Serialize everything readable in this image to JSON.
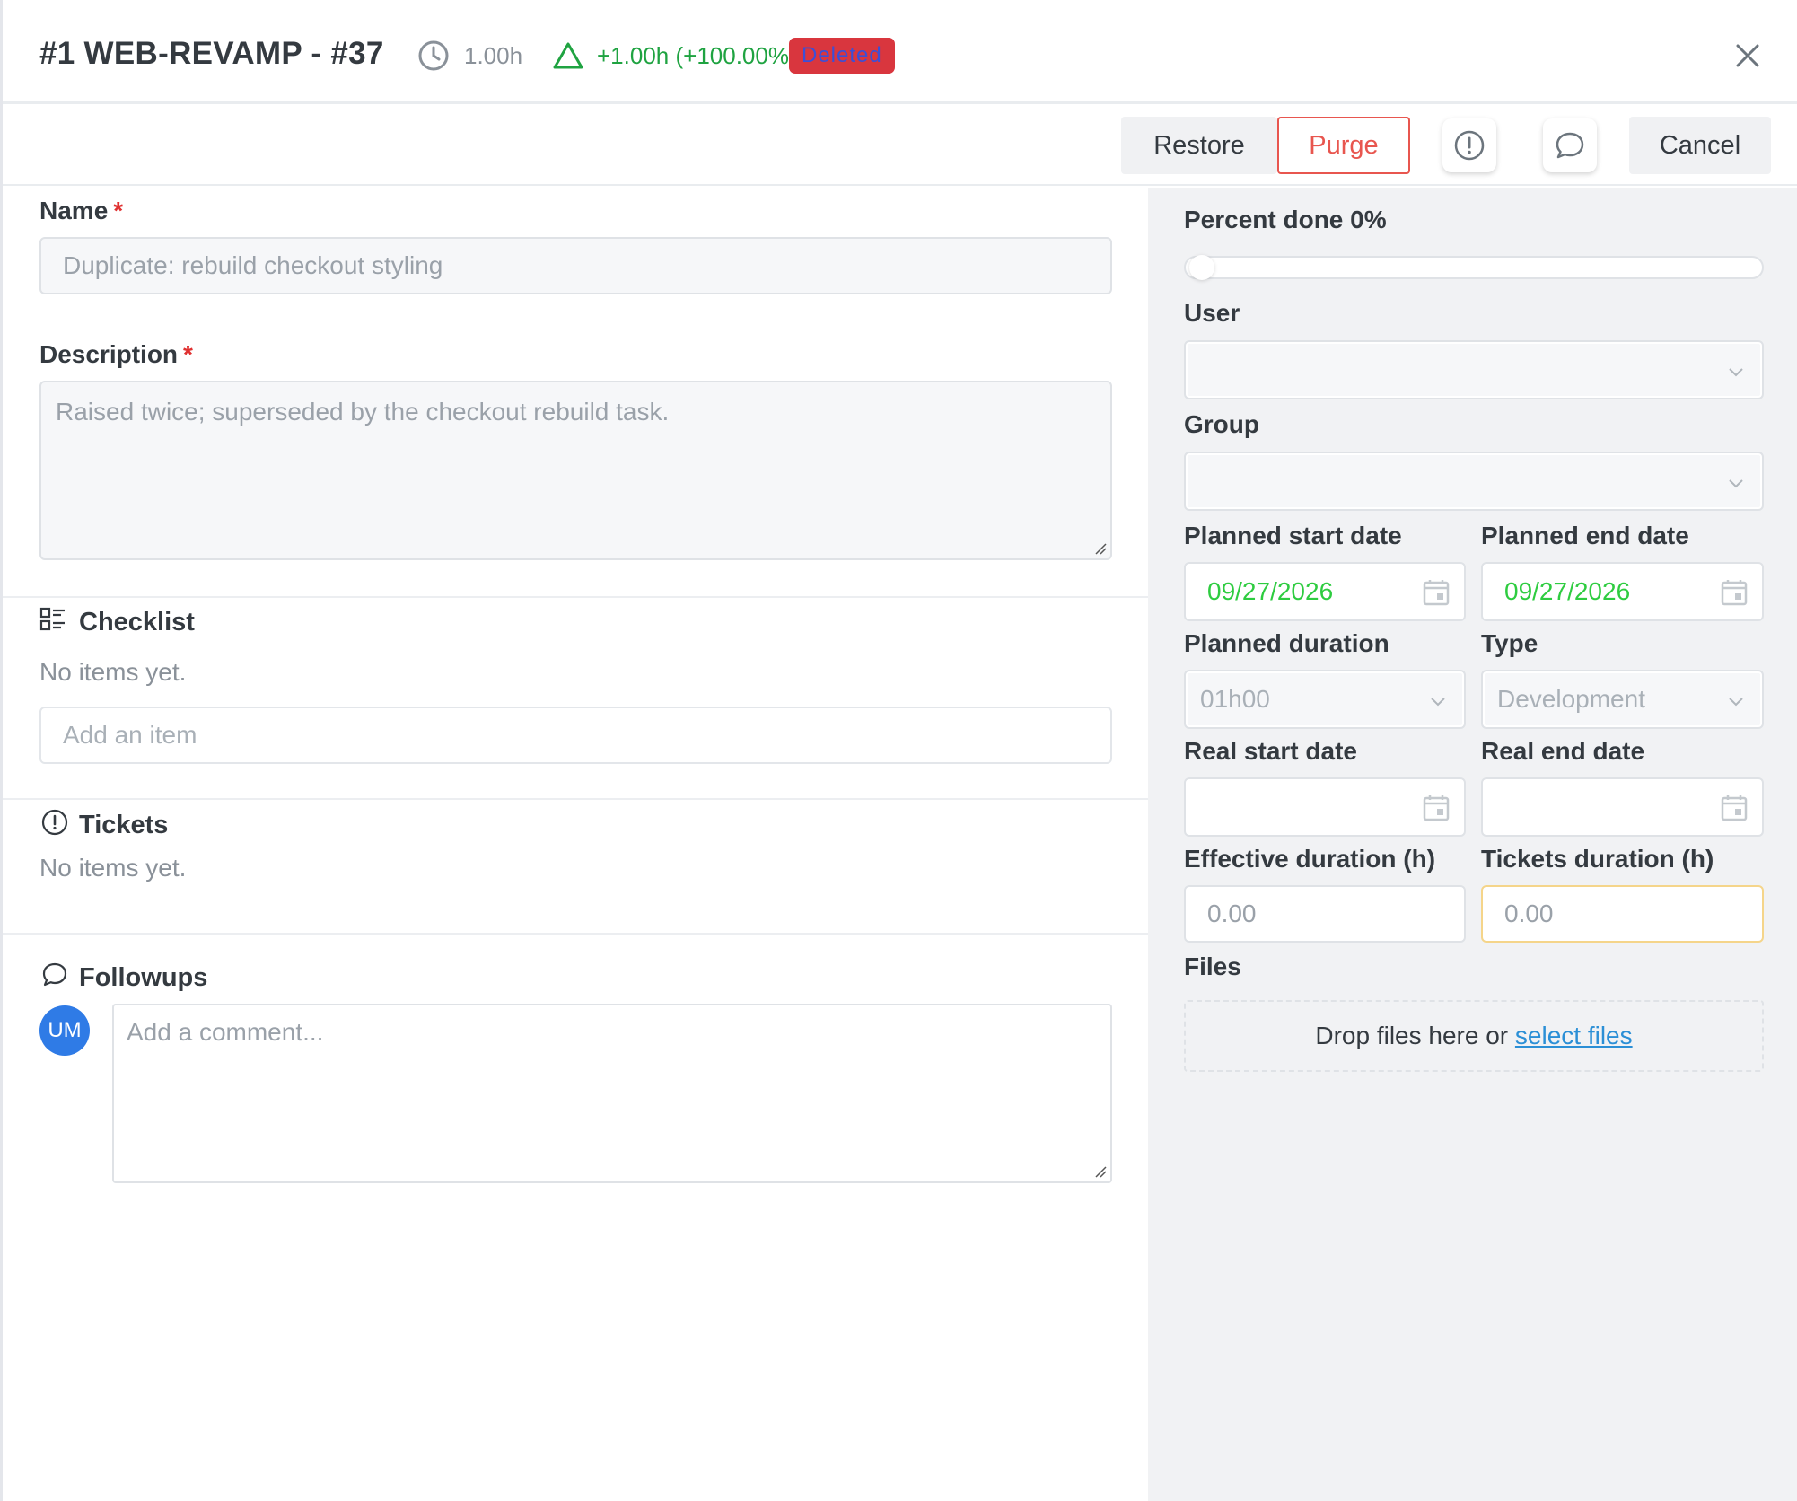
{
  "header": {
    "title": "#1 WEB-REVAMP - #37",
    "time": "1.00h",
    "delta": "+1.00h (+100.00%)",
    "status_badge": "Deleted"
  },
  "toolbar": {
    "restore_label": "Restore",
    "purge_label": "Purge",
    "cancel_label": "Cancel",
    "tickets_icon": "exclamation-circle-icon",
    "comments_icon": "chat-bubble-icon"
  },
  "form": {
    "name_label": "Name",
    "required_mark": "*",
    "name_value": "Duplicate: rebuild checkout styling",
    "description_label": "Description",
    "description_value": "Raised twice; superseded by the checkout rebuild task."
  },
  "checklist": {
    "title": "Checklist",
    "empty_text": "No items yet.",
    "add_placeholder": "Add an item"
  },
  "tickets": {
    "title": "Tickets",
    "empty_text": "No items yet."
  },
  "followups": {
    "title": "Followups",
    "avatar_initials": "UM",
    "comment_placeholder": "Add a comment..."
  },
  "sidebar": {
    "percent_label": "Percent done 0%",
    "percent_done": 0,
    "user_label": "User",
    "group_label": "Group",
    "planned_start_label": "Planned start date",
    "planned_start_value": "09/27/2026",
    "planned_end_label": "Planned end date",
    "planned_end_value": "09/27/2026",
    "planned_duration_label": "Planned duration",
    "planned_duration_value": "01h00",
    "type_label": "Type",
    "type_value": "Development",
    "real_start_label": "Real start date",
    "real_end_label": "Real end date",
    "effective_duration_label": "Effective duration (h)",
    "effective_duration_value": "0.00",
    "tickets_duration_label": "Tickets duration (h)",
    "tickets_duration_value": "0.00",
    "files_label": "Files",
    "dropzone_text": "Drop files here or",
    "dropzone_link": "select files"
  },
  "colors": {
    "danger": "#d9363e",
    "success": "#1fa341",
    "date_green": "#2ecc40",
    "accent_blue": "#2f7be6",
    "purge_red": "#e8564f"
  }
}
